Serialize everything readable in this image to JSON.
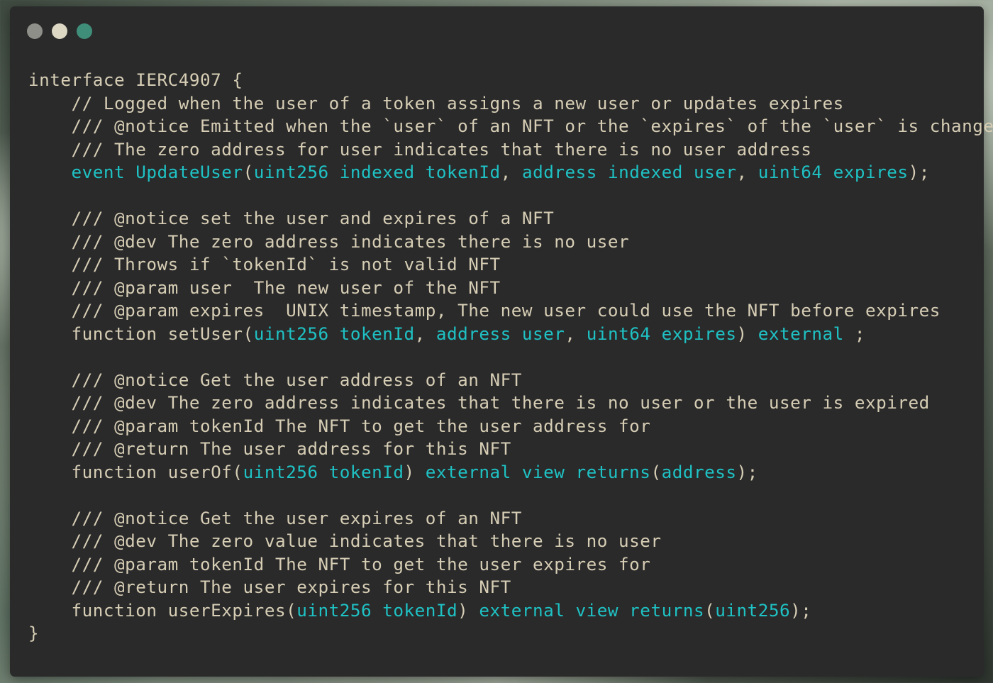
{
  "window": {
    "buttons": [
      "close",
      "minimize",
      "zoom"
    ],
    "colors": {
      "background": "#2a2a2b",
      "text": "#d6cdb4",
      "keyword": "#1fc2c4",
      "close": "#8f8f8a",
      "minimize": "#dcd8c4",
      "zoom": "#3f8e79"
    }
  },
  "code": {
    "lines": [
      [
        {
          "t": "interface IERC4907 {",
          "c": "plain"
        }
      ],
      [
        {
          "t": "    // Logged when the user of a token assigns a new user or updates expires",
          "c": "plain"
        }
      ],
      [
        {
          "t": "    /// @notice Emitted when the `user` of an NFT or the `expires` of the `user` is changed",
          "c": "plain"
        }
      ],
      [
        {
          "t": "    /// The zero address for user indicates that there is no user address",
          "c": "plain"
        }
      ],
      [
        {
          "t": "    ",
          "c": "plain"
        },
        {
          "t": "event UpdateUser",
          "c": "kw"
        },
        {
          "t": "(",
          "c": "plain"
        },
        {
          "t": "uint256 indexed tokenId",
          "c": "kw"
        },
        {
          "t": ", ",
          "c": "plain"
        },
        {
          "t": "address indexed user",
          "c": "kw"
        },
        {
          "t": ", ",
          "c": "plain"
        },
        {
          "t": "uint64 expires",
          "c": "kw"
        },
        {
          "t": ");",
          "c": "plain"
        }
      ],
      [],
      [
        {
          "t": "    /// @notice set the user and expires of a NFT",
          "c": "plain"
        }
      ],
      [
        {
          "t": "    /// @dev The zero address indicates there is no user",
          "c": "plain"
        }
      ],
      [
        {
          "t": "    /// Throws if `tokenId` is not valid NFT",
          "c": "plain"
        }
      ],
      [
        {
          "t": "    /// @param user  The new user of the NFT",
          "c": "plain"
        }
      ],
      [
        {
          "t": "    /// @param expires  UNIX timestamp, The new user could use the NFT before expires",
          "c": "plain"
        }
      ],
      [
        {
          "t": "    function setUser(",
          "c": "plain"
        },
        {
          "t": "uint256 tokenId",
          "c": "kw"
        },
        {
          "t": ", ",
          "c": "plain"
        },
        {
          "t": "address user",
          "c": "kw"
        },
        {
          "t": ", ",
          "c": "plain"
        },
        {
          "t": "uint64 expires",
          "c": "kw"
        },
        {
          "t": ") ",
          "c": "plain"
        },
        {
          "t": "external",
          "c": "kw"
        },
        {
          "t": " ;",
          "c": "plain"
        }
      ],
      [],
      [
        {
          "t": "    /// @notice Get the user address of an NFT",
          "c": "plain"
        }
      ],
      [
        {
          "t": "    /// @dev The zero address indicates that there is no user or the user is expired",
          "c": "plain"
        }
      ],
      [
        {
          "t": "    /// @param tokenId The NFT to get the user address for",
          "c": "plain"
        }
      ],
      [
        {
          "t": "    /// @return The user address for this NFT",
          "c": "plain"
        }
      ],
      [
        {
          "t": "    function userOf(",
          "c": "plain"
        },
        {
          "t": "uint256 tokenId",
          "c": "kw"
        },
        {
          "t": ") ",
          "c": "plain"
        },
        {
          "t": "external view returns",
          "c": "kw"
        },
        {
          "t": "(",
          "c": "plain"
        },
        {
          "t": "address",
          "c": "kw"
        },
        {
          "t": ");",
          "c": "plain"
        }
      ],
      [],
      [
        {
          "t": "    /// @notice Get the user expires of an NFT",
          "c": "plain"
        }
      ],
      [
        {
          "t": "    /// @dev The zero value indicates that there is no user",
          "c": "plain"
        }
      ],
      [
        {
          "t": "    /// @param tokenId The NFT to get the user expires for",
          "c": "plain"
        }
      ],
      [
        {
          "t": "    /// @return The user expires for this NFT",
          "c": "plain"
        }
      ],
      [
        {
          "t": "    function userExpires(",
          "c": "plain"
        },
        {
          "t": "uint256 tokenId",
          "c": "kw"
        },
        {
          "t": ") ",
          "c": "plain"
        },
        {
          "t": "external view returns",
          "c": "kw"
        },
        {
          "t": "(",
          "c": "plain"
        },
        {
          "t": "uint256",
          "c": "kw"
        },
        {
          "t": ");",
          "c": "plain"
        }
      ],
      [
        {
          "t": "}",
          "c": "plain"
        }
      ]
    ]
  }
}
